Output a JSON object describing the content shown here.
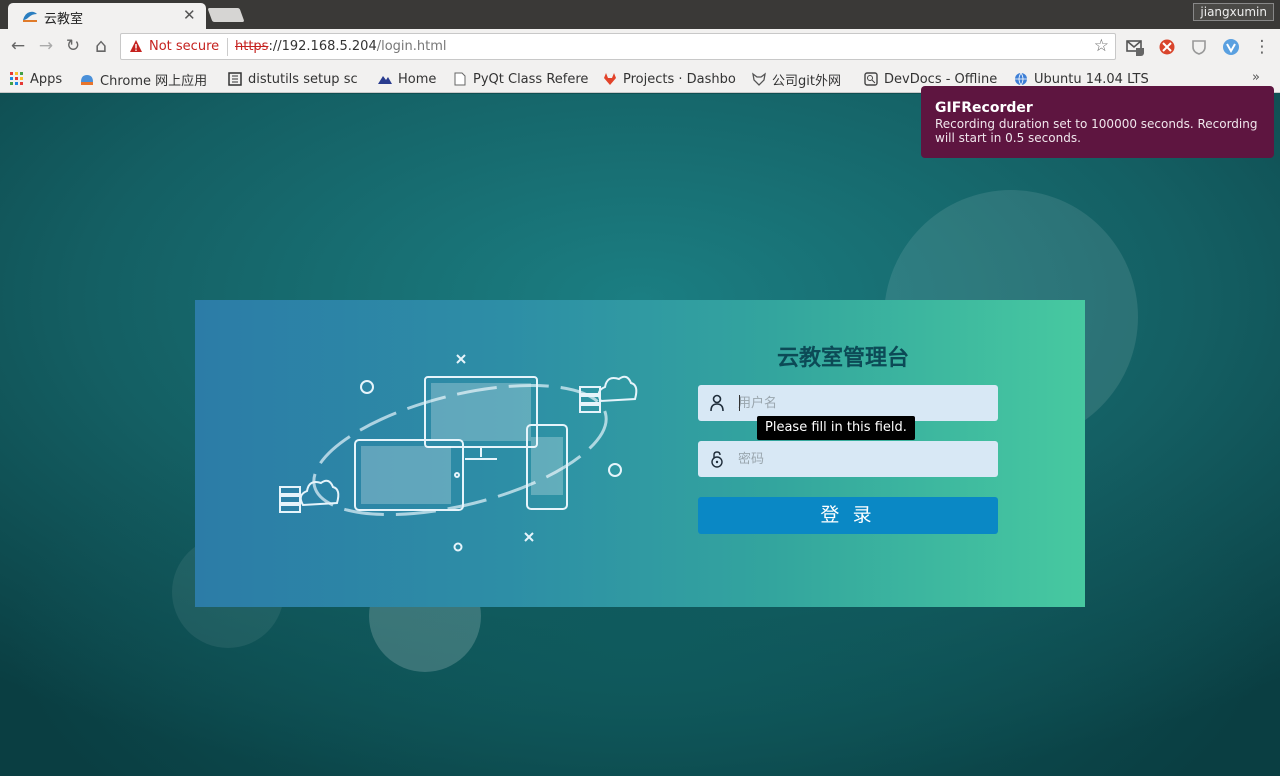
{
  "tab": {
    "title": "云教室",
    "close_glyph": "✕"
  },
  "user": "jiangxumin",
  "toolbar": {
    "back": "←",
    "forward": "→",
    "reload": "↻",
    "home": "⌂",
    "security_label": "Not secure",
    "url_scheme": "https",
    "url_sep": "://",
    "url_host": "192.168.5.204",
    "url_path": "/login.html",
    "star": "☆",
    "menu": "⋮"
  },
  "bookmarks": [
    {
      "label": "Apps",
      "icon": "apps-grid-icon"
    },
    {
      "label": "Chrome 网上应用",
      "icon": "chrome-webstore-icon"
    },
    {
      "label": "distutils setup sc",
      "icon": "doc-icon"
    },
    {
      "label": "Home",
      "icon": "mountain-icon"
    },
    {
      "label": "PyQt Class Refere",
      "icon": "page-icon"
    },
    {
      "label": "Projects · Dashbo",
      "icon": "gitlab-icon"
    },
    {
      "label": "公司git外网",
      "icon": "fox-icon"
    },
    {
      "label": "DevDocs - Offline",
      "icon": "devdocs-icon"
    },
    {
      "label": "Ubuntu 14.04 LTS",
      "icon": "globe-icon"
    }
  ],
  "bookmarks_more": "»",
  "login": {
    "title": "云教室管理台",
    "username_placeholder": "用户名",
    "password_placeholder": "密码",
    "submit_label": "登 录",
    "validation_tooltip": "Please fill in this field."
  },
  "notification": {
    "title": "GIFRecorder",
    "body": "Recording duration set to 100000 seconds. Recording will start in 0.5 seconds."
  },
  "colors": {
    "panel_left": "#2c7ca7",
    "panel_right": "#47c9a0",
    "button": "#0a88c5",
    "notification_bg": "#5e1540",
    "title_color": "#0c4a56"
  }
}
